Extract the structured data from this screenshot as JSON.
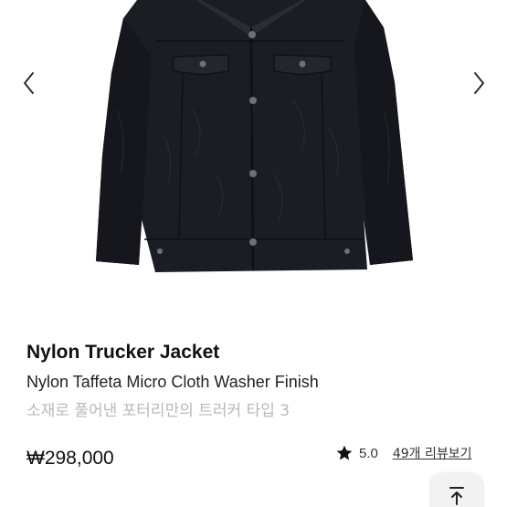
{
  "gallery": {
    "prev_icon": "chevron-left-icon",
    "next_icon": "chevron-right-icon"
  },
  "product": {
    "title": "Nylon Trucker Jacket",
    "subtitle": "Nylon Taffeta Micro Cloth Washer Finish",
    "description": "소재로 풀어낸 포터리만의 트러커 타입 3",
    "price": "₩298,000",
    "rating": "5.0",
    "review_link": "49개 리뷰보기"
  },
  "colors": {
    "jacket": "#1b1d24",
    "muted_text": "#b8b8b8"
  },
  "scroll_top_icon": "arrow-up-to-top-icon"
}
